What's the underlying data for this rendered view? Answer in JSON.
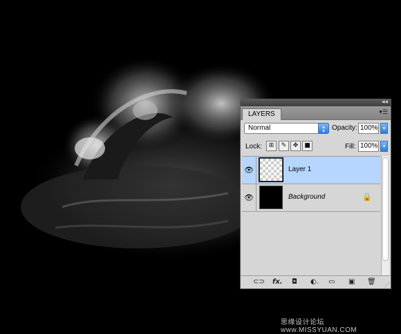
{
  "panel": {
    "collapse_icon": "double-chevron-left-icon",
    "tab_label": "LAYERS",
    "menu_icon": "panel-menu-icon",
    "blend_mode": "Normal",
    "opacity_label": "Opacity:",
    "opacity_value": "100%",
    "lock_label": "Lock:",
    "lock_icons": [
      "lock-transparent-pixels-icon",
      "lock-image-pixels-icon",
      "lock-position-icon",
      "lock-all-icon"
    ],
    "fill_label": "Fill:",
    "fill_value": "100%",
    "layers": [
      {
        "name": "Layer 1",
        "selected": true,
        "visible": true,
        "thumbnail": "transparent"
      },
      {
        "name": "Background",
        "selected": false,
        "visible": true,
        "thumbnail": "black",
        "locked": true
      }
    ],
    "bottom_icons": [
      "link-layers-icon",
      "fx-icon",
      "add-mask-icon",
      "adjustment-layer-icon",
      "new-group-icon",
      "new-layer-icon",
      "trash-icon"
    ]
  },
  "watermark": "思缘设计论坛  www.MISSYUAN.COM",
  "colors": {
    "selection": "#b6d6ff",
    "accent": "#2f7de0",
    "panel_bg": "#d6d6d6"
  }
}
